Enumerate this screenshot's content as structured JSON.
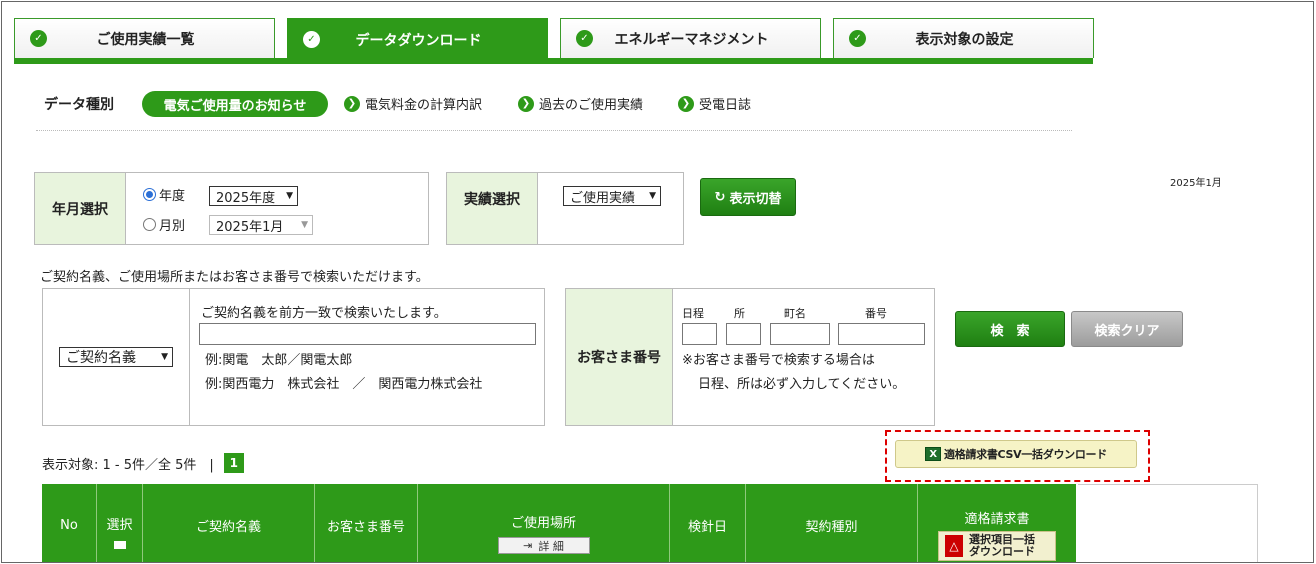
{
  "tabs": [
    {
      "label": "ご使用実績一覧",
      "active": false
    },
    {
      "label": "データダウンロード",
      "active": true
    },
    {
      "label": "エネルギーマネジメント",
      "active": false
    },
    {
      "label": "表示対象の設定",
      "active": false
    }
  ],
  "data_type": {
    "label": "データ種別",
    "selected": "電気ご使用量のお知らせ",
    "links": [
      "電気料金の計算内訳",
      "過去のご使用実績",
      "受電日誌"
    ]
  },
  "period": {
    "label": "年月選択",
    "year_radio": "年度",
    "month_radio": "月別",
    "year_value": "2025年度",
    "month_value": "2025年1月"
  },
  "result": {
    "label": "実績選択",
    "value": "ご使用実績"
  },
  "toggle_button": "表示切替",
  "date_right": "2025年1月",
  "search": {
    "note": "ご契約名義、ご使用場所またはお客さま番号で検索いただけます。",
    "field_select": "ご契約名義",
    "hint": "ご契約名義を前方一致で検索いたします。",
    "example1": "例:関電　太郎／関電太郎",
    "example2": "例:関西電力　株式会社　／　関西電力株式会社",
    "customer_label": "お客さま番号",
    "col_labels": [
      "日程",
      "所",
      "町名",
      "番号"
    ],
    "customer_note1": "※お客さま番号で検索する場合は",
    "customer_note2": "日程、所は必ず入力してください。",
    "search_button": "検　索",
    "clear_button": "検索クリア"
  },
  "csv_button": "適格請求書CSV一括ダウンロード",
  "list": {
    "count_text": "表示対象: 1 - 5件／全 5件　|",
    "page": "1",
    "headers": [
      "No",
      "選択",
      "ご契約名義",
      "お客さま番号",
      "ご使用場所",
      "検針日",
      "契約種別",
      "適格請求書"
    ],
    "detail_button": "詳 細",
    "pdf_button_line1": "選択項目一括",
    "pdf_button_line2": "ダウンロード"
  },
  "colors": {
    "brand_green": "#2e9a19",
    "light_green": "#e8f4dd"
  }
}
